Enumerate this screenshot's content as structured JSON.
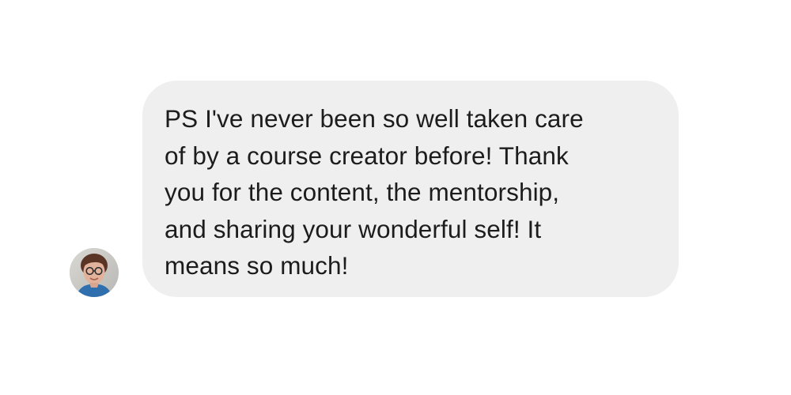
{
  "conversation": {
    "message": {
      "text": "PS I've never been so well taken care\nof by a course creator before! Thank\nyou for the content, the mentorship,\nand sharing your wonderful self! It\nmeans so much!",
      "sender_avatar_icon": "user-avatar-photo"
    }
  },
  "colors": {
    "page_background": "#ffffff",
    "bubble_background": "#efefef",
    "text": "#1c1c1c"
  }
}
